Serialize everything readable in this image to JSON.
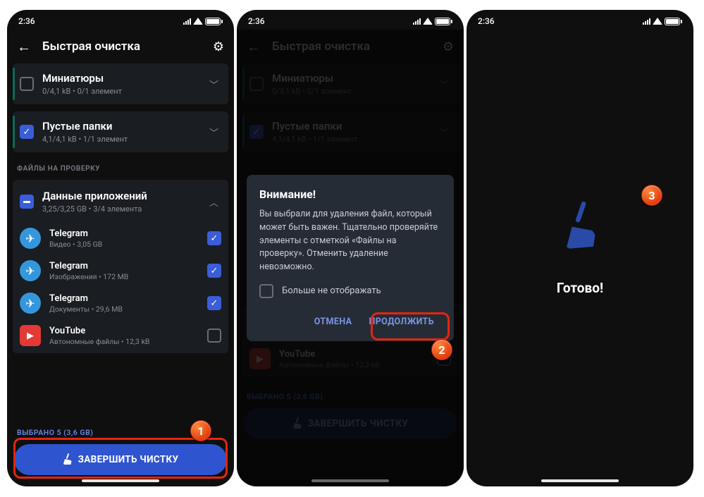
{
  "status": {
    "time": "2:36"
  },
  "appbar_title": "Быстрая очистка",
  "cards": {
    "thumbnails": {
      "title": "Миниатюры",
      "sub": "0/4,1 kB • 0/1 элемент"
    },
    "empty_folders": {
      "title": "Пустые папки",
      "sub": "4,1/4,1 kB • 1/1 элемент"
    }
  },
  "section_label": "ФАЙЛЫ НА ПРОВЕРКУ",
  "app_data": {
    "title": "Данные приложений",
    "sub": "3,25/3,25 GB • 3/4 элемента",
    "items": [
      {
        "app": "Telegram",
        "sub": "Видео • 3,05 GB",
        "checked": true,
        "icon": "tg"
      },
      {
        "app": "Telegram",
        "sub": "Изображения • 172 MB",
        "checked": true,
        "icon": "tg"
      },
      {
        "app": "Telegram",
        "sub": "Документы • 29,6 MB",
        "checked": true,
        "icon": "tg"
      },
      {
        "app": "YouTube",
        "sub": "Автономные файлы • 12,3 kB",
        "checked": false,
        "icon": "yt"
      }
    ]
  },
  "selected_text": "ВЫБРАНО 5 (3,6 GB)",
  "button_label": "ЗАВЕРШИТЬ ЧИСТКУ",
  "modal": {
    "title": "Внимание!",
    "body": "Вы выбрали для удаления файл, который может быть важен. Тщательно проверяйте элементы с отметкой «Файлы на проверку». Отменить удаление невозможно.",
    "dont_show": "Больше не отображать",
    "cancel": "ОТМЕНА",
    "continue": "ПРОДОЛЖИТЬ"
  },
  "done_text": "Готово!",
  "badges": {
    "b1": "1",
    "b2": "2",
    "b3": "3"
  }
}
